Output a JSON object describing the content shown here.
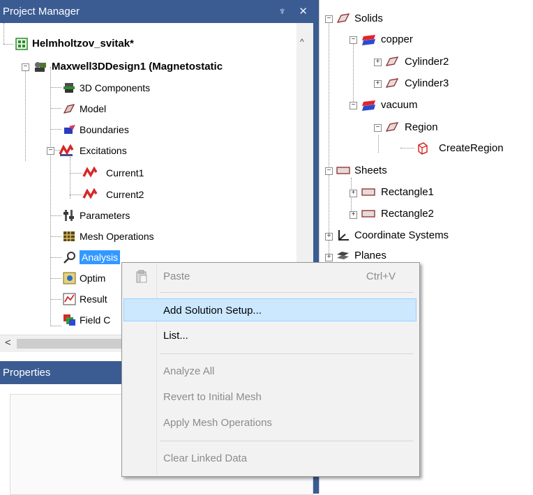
{
  "project_manager": {
    "title": "Project Manager",
    "pin_glyph": "♆",
    "close_glyph": "✕",
    "tree": [
      {
        "label": "Helmholtzov_svitak*",
        "icon": "project-icon"
      },
      {
        "label": "Maxwell3DDesign1 (Magnetostatic",
        "icon": "maxwell-design-icon"
      },
      {
        "label": "3D Components",
        "icon": "components-icon"
      },
      {
        "label": "Model",
        "icon": "model-icon"
      },
      {
        "label": "Boundaries",
        "icon": "boundaries-icon"
      },
      {
        "label": "Excitations",
        "icon": "excitations-icon"
      },
      {
        "label": "Current1",
        "icon": "current-icon"
      },
      {
        "label": "Current2",
        "icon": "current-icon"
      },
      {
        "label": "Parameters",
        "icon": "parameters-icon"
      },
      {
        "label": "Mesh Operations",
        "icon": "mesh-operations-icon"
      },
      {
        "label": "Analysis",
        "icon": "analysis-icon"
      },
      {
        "label": "Optim",
        "icon": "optimetrics-icon"
      },
      {
        "label": "Result",
        "icon": "results-icon"
      },
      {
        "label": "Field C",
        "icon": "field-overlays-icon"
      }
    ]
  },
  "properties": {
    "title": "Properties"
  },
  "model_tree": [
    {
      "label": "Solids",
      "icon": "solid-icon"
    },
    {
      "label": "copper",
      "icon": "material-icon",
      "color": "#e0262a"
    },
    {
      "label": "Cylinder2",
      "icon": "solid-icon"
    },
    {
      "label": "Cylinder3",
      "icon": "solid-icon"
    },
    {
      "label": "vacuum",
      "icon": "material-icon",
      "color": "#e0262a"
    },
    {
      "label": "Region",
      "icon": "solid-icon"
    },
    {
      "label": "CreateRegion",
      "icon": "create-region-icon"
    },
    {
      "label": "Sheets",
      "icon": "sheet-icon"
    },
    {
      "label": "Rectangle1",
      "icon": "sheet-icon"
    },
    {
      "label": "Rectangle2",
      "icon": "sheet-icon"
    },
    {
      "label": "Coordinate Systems",
      "icon": "coordinate-system-icon"
    },
    {
      "label": "Planes",
      "icon": "planes-icon"
    }
  ],
  "context_menu": {
    "paste": {
      "label": "Paste",
      "shortcut": "Ctrl+V",
      "icon": "paste-icon"
    },
    "add_solution_setup": {
      "label": "Add Solution Setup..."
    },
    "list": {
      "label": "List..."
    },
    "analyze_all": {
      "label": "Analyze All"
    },
    "revert_mesh": {
      "label": "Revert to Initial Mesh"
    },
    "apply_mesh_ops": {
      "label": "Apply Mesh Operations"
    },
    "clear_linked": {
      "label": "Clear Linked Data"
    }
  },
  "colors": {
    "title_bar": "#3b5c93",
    "selection": "#3399ff",
    "menu_highlight": "#cce8ff"
  }
}
